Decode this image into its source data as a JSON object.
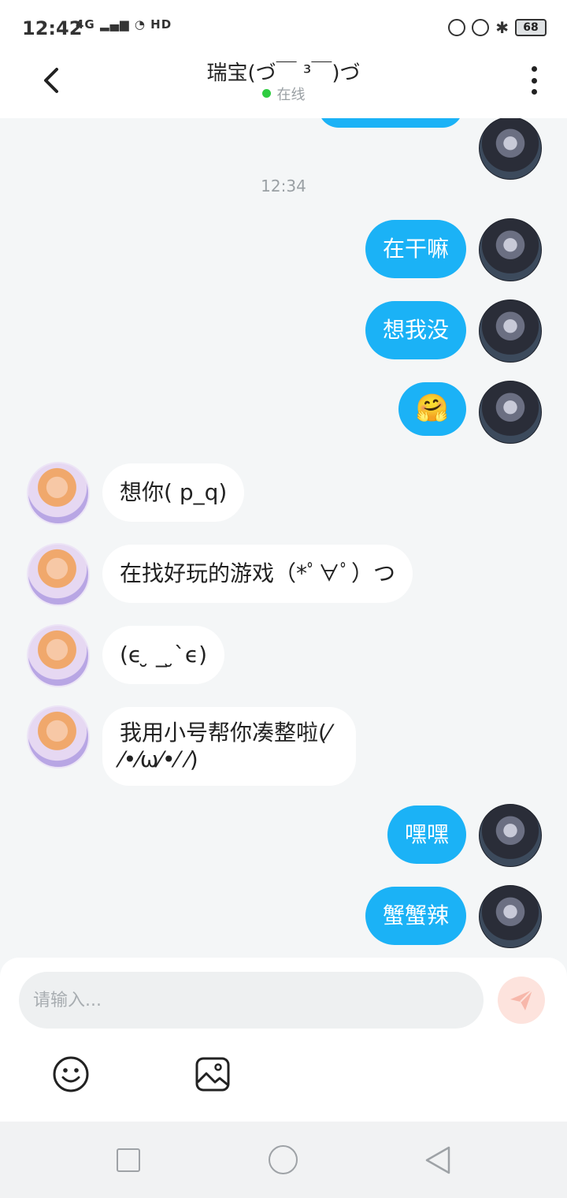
{
  "status_bar": {
    "time": "12:42",
    "network": "4G",
    "hd": "HD",
    "battery": "68"
  },
  "header": {
    "title": "瑞宝(づ￣ ³￣)づ",
    "status": "在线",
    "status_color": "#2ecc40"
  },
  "chat": {
    "timestamp": "12:34",
    "messages": [
      {
        "side": "out",
        "text": "在干嘛"
      },
      {
        "side": "out",
        "text": "想我没"
      },
      {
        "side": "out",
        "text": "🤗"
      },
      {
        "side": "in",
        "text": "想你( p_q)"
      },
      {
        "side": "in",
        "text": "在找好玩的游戏（*ﾟ∀ﾟ）つ"
      },
      {
        "side": "in",
        "text": "(ϵ ̮ _ ̮`ϵ)"
      },
      {
        "side": "in",
        "text": "我用小号帮你凑整啦(⁄ ⁄•⁄ω⁄•⁄ ⁄)"
      },
      {
        "side": "out",
        "text": "嘿嘿"
      },
      {
        "side": "out",
        "text": "蟹蟹辣"
      }
    ]
  },
  "composer": {
    "placeholder": "请输入...",
    "send_icon": "send-icon",
    "emoji_icon": "smile-icon",
    "image_icon": "image-icon"
  },
  "colors": {
    "outgoing_bubble": "#1bb2f6",
    "incoming_bubble": "#ffffff",
    "background": "#f4f6f7"
  }
}
